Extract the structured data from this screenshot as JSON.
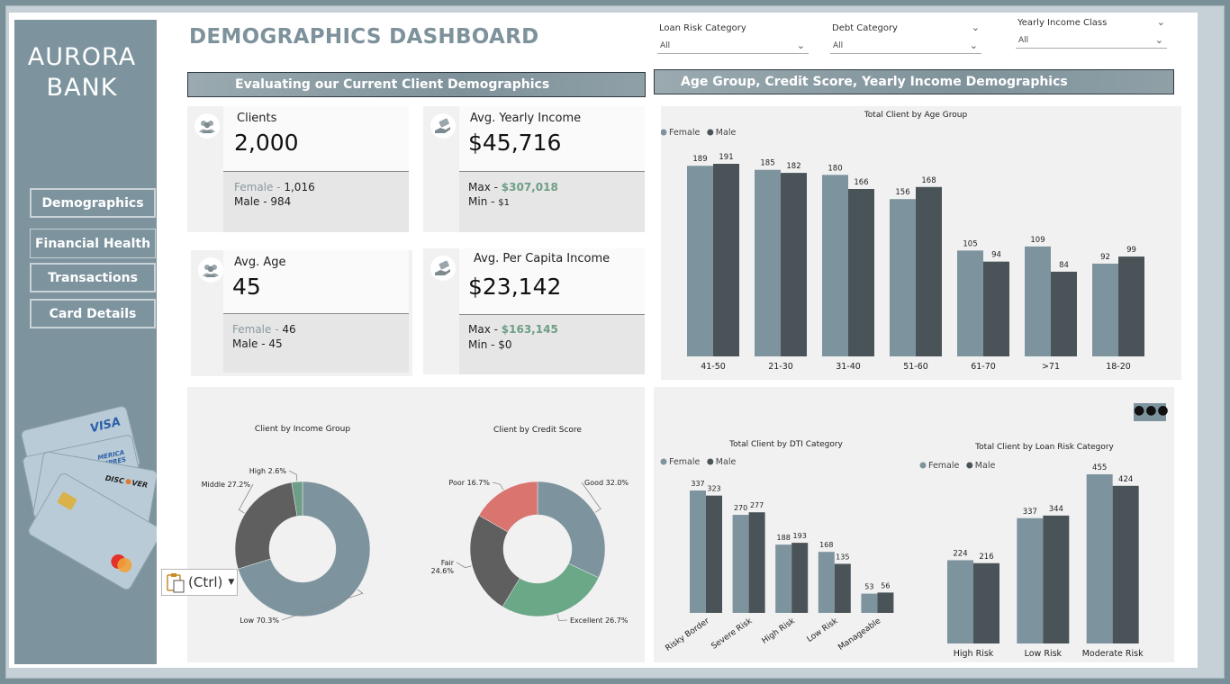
{
  "brand": {
    "line1": "AURORA",
    "line2": "BANK"
  },
  "nav": [
    "Demographics",
    "Financial Health",
    "Transactions",
    "Card Details"
  ],
  "page_title": "DEMOGRAPHICS DASHBOARD",
  "filters": [
    {
      "label": "Loan Risk Category",
      "value": "All"
    },
    {
      "label": "Debt Category",
      "value": "All"
    },
    {
      "label": "Yearly Income Class",
      "value": "All"
    }
  ],
  "banners": {
    "left": "Evaluating our Current Client Demographics",
    "right": "Age Group, Credit Score, Yearly Income Demographics"
  },
  "cards": {
    "clients": {
      "label": "Clients",
      "value": "2,000",
      "l1a": "Female - ",
      "l1b": "1,016",
      "l2": "Male - 984"
    },
    "income": {
      "label": "Avg. Yearly Income",
      "value": "$45,716",
      "l1a": "Max - ",
      "l1b": "$307,018",
      "l2a": "Min - ",
      "l2b": "$1"
    },
    "age": {
      "label": "Avg. Age",
      "value": "45",
      "l1a": "Female - ",
      "l1b": "46",
      "l2": "Male - 45"
    },
    "percapita": {
      "label": "Avg. Per Capita Income",
      "value": "$23,142",
      "l1a": "Max - ",
      "l1b": "$163,145",
      "l2": "Min - $0"
    }
  },
  "colors": {
    "female": "#7d949e",
    "male": "#4a5458",
    "low": "#7d949e",
    "middle": "#5f5f5f",
    "high": "#6e9e85",
    "good": "#7d949e",
    "excellent": "#6aa888",
    "fair": "#5f5f5f",
    "poor": "#d9746f"
  },
  "more_icon": "ellipsis-icon",
  "paste_label": "(Ctrl)",
  "chart_data": [
    {
      "type": "bar",
      "title": "Total Client by Age Group",
      "categories": [
        "41-50",
        "21-30",
        "31-40",
        "51-60",
        "61-70",
        ">71",
        "18-20"
      ],
      "series": [
        {
          "name": "Female",
          "values": [
            189,
            185,
            180,
            156,
            105,
            109,
            92
          ]
        },
        {
          "name": "Male",
          "values": [
            191,
            182,
            166,
            168,
            94,
            84,
            99
          ]
        }
      ],
      "legend": "top-left"
    },
    {
      "type": "pie",
      "title": "Client by Income Group",
      "slices": [
        {
          "label": "Low",
          "value": 70.3
        },
        {
          "label": "Middle",
          "value": 27.2
        },
        {
          "label": "High",
          "value": 2.6
        }
      ],
      "display_labels": [
        "Low 70.3%",
        "Middle 27.2%",
        "High 2.6%"
      ]
    },
    {
      "type": "pie",
      "title": "Client by Credit Score",
      "slices": [
        {
          "label": "Good",
          "value": 32.0
        },
        {
          "label": "Excellent",
          "value": 26.7
        },
        {
          "label": "Fair",
          "value": 24.6
        },
        {
          "label": "Poor",
          "value": 16.7
        }
      ],
      "display_labels": [
        "Good 32.0%",
        "Excellent 26.7%",
        "Fair",
        "24.6%",
        "Poor 16.7%"
      ]
    },
    {
      "type": "bar",
      "title": "Total Client by DTI Category",
      "categories": [
        "Risky Border",
        "Severe Risk",
        "High Risk",
        "Low Risk",
        "Manageable"
      ],
      "series": [
        {
          "name": "Female",
          "values": [
            337,
            270,
            188,
            168,
            53
          ]
        },
        {
          "name": "Male",
          "values": [
            323,
            277,
            193,
            135,
            56
          ]
        }
      ],
      "legend": "top-left"
    },
    {
      "type": "bar",
      "title": "Total Client by Loan Risk Category",
      "categories": [
        "High Risk",
        "Low Risk",
        "Moderate Risk"
      ],
      "series": [
        {
          "name": "Female",
          "values": [
            224,
            337,
            455
          ]
        },
        {
          "name": "Male",
          "values": [
            216,
            344,
            424
          ]
        }
      ],
      "legend": "top-left"
    }
  ]
}
